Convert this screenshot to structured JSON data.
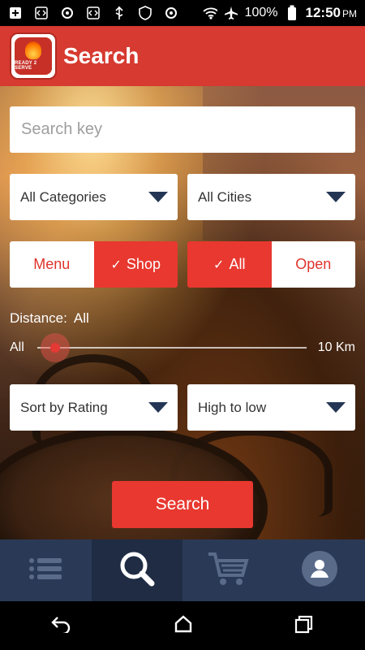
{
  "status_bar": {
    "battery": "100%",
    "time": "12:50",
    "time_suffix": "PM"
  },
  "app_bar": {
    "title": "Search",
    "logo_text": "READY 2 SERVE"
  },
  "search": {
    "placeholder": "Search key"
  },
  "filters": {
    "categories": "All Categories",
    "cities": "All Cities",
    "type_options": [
      {
        "label": "Menu",
        "selected": false
      },
      {
        "label": "Shop",
        "selected": true
      }
    ],
    "status_options": [
      {
        "label": "All",
        "selected": true
      },
      {
        "label": "Open",
        "selected": false
      }
    ]
  },
  "distance": {
    "label": "Distance:",
    "value": "All",
    "min_label": "All",
    "max_label": "10 Km",
    "level": 0
  },
  "sort": {
    "by": "Sort by Rating",
    "order": "High to low"
  },
  "search_button": {
    "label": "Search"
  },
  "tabbar": {
    "tabs": [
      "list-icon",
      "search-icon",
      "cart-icon",
      "profile-icon"
    ],
    "active_index": 1
  },
  "colors": {
    "accent": "#e8382f",
    "app_bar": "#d63a30",
    "tabbar": "#2a3a56"
  }
}
